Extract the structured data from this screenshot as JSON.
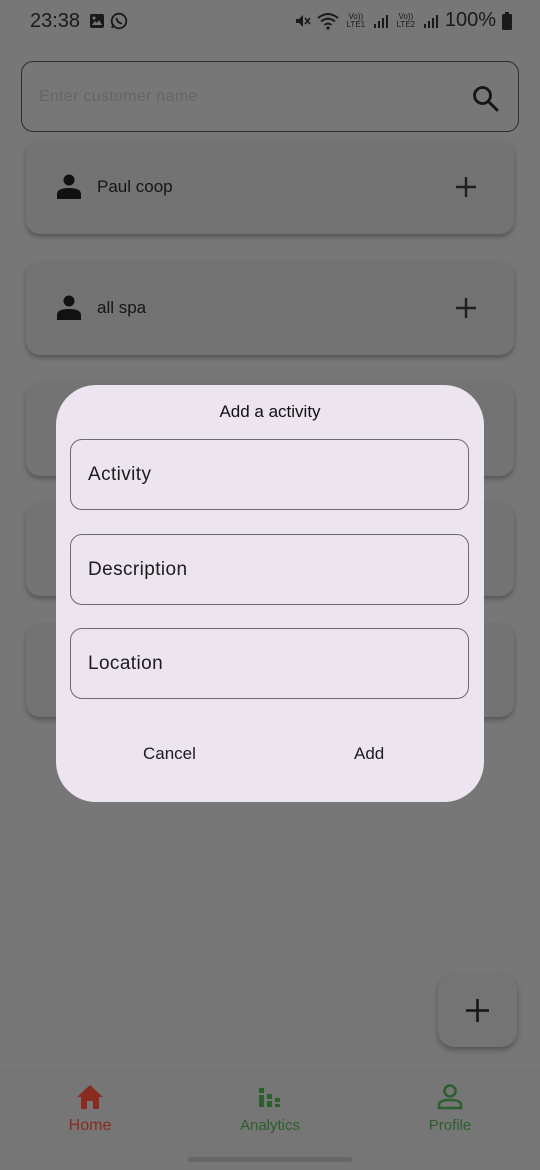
{
  "status_bar": {
    "time": "23:38",
    "battery": "100%",
    "sim1_label": "Vo)) LTE1",
    "sim2_label": "Vo)) LTE2"
  },
  "search": {
    "placeholder": "Enter customer name"
  },
  "customers": [
    {
      "name": "Paul coop"
    },
    {
      "name": "all spa"
    }
  ],
  "dialog": {
    "title": "Add a activity",
    "fields": [
      {
        "label": "Activity"
      },
      {
        "label": "Description"
      },
      {
        "label": "Location"
      }
    ],
    "cancel_label": "Cancel",
    "add_label": "Add"
  },
  "nav": {
    "items": [
      {
        "label": "Home",
        "icon": "home-icon",
        "color": "#8a2b1f",
        "active": true
      },
      {
        "label": "Analytics",
        "icon": "analytics-icon",
        "color": "#2c5f2c"
      },
      {
        "label": "Profile",
        "icon": "person-outline-icon",
        "color": "#2c5f2c"
      }
    ]
  },
  "colors": {
    "scrim_background": "#777777",
    "dialog_background": "#ece5f0",
    "home_accent": "#8a2b1f",
    "nav_accent": "#2c5f2c"
  }
}
